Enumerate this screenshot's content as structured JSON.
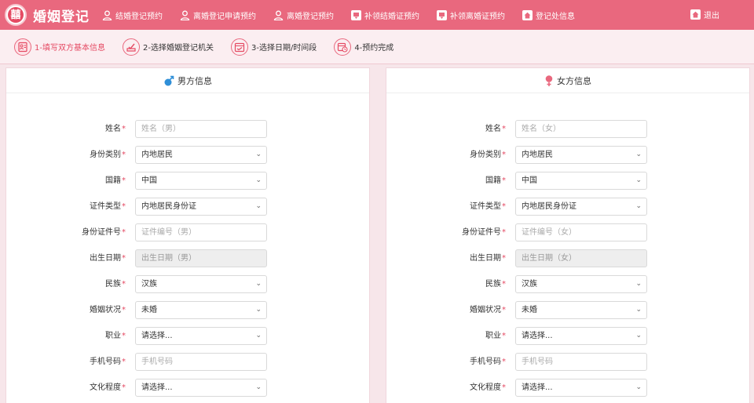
{
  "header": {
    "logo_glyph": "囍",
    "title": "婚姻登记",
    "nav": [
      {
        "label": "结婚登记预约",
        "icon": "person-icon"
      },
      {
        "label": "离婚登记申请预约",
        "icon": "person-icon"
      },
      {
        "label": "离婚登记预约",
        "icon": "person-icon"
      },
      {
        "label": "补领结婚证预约",
        "icon": "certificate-icon"
      },
      {
        "label": "补领离婚证预约",
        "icon": "certificate-icon"
      },
      {
        "label": "登记处信息",
        "icon": "home-icon"
      }
    ],
    "logout_label": "退出"
  },
  "steps": [
    {
      "label": "1-填写双方基本信息",
      "active": true
    },
    {
      "label": "2-选择婚姻登记机关",
      "active": false
    },
    {
      "label": "3-选择日期/时间段",
      "active": false
    },
    {
      "label": "4-预约完成",
      "active": false
    }
  ],
  "colors": {
    "brand": "#e9687e",
    "accent": "#e54a63",
    "male": "#2f8fd8",
    "female": "#e9687e"
  },
  "male": {
    "title": "男方信息",
    "fields": [
      {
        "label": "姓名",
        "type": "input",
        "placeholder": "姓名（男）"
      },
      {
        "label": "身份类别",
        "type": "select",
        "value": "内地居民"
      },
      {
        "label": "国籍",
        "type": "select",
        "value": "中国"
      },
      {
        "label": "证件类型",
        "type": "select",
        "value": "内地居民身份证"
      },
      {
        "label": "身份证件号",
        "type": "input",
        "placeholder": "证件编号（男）"
      },
      {
        "label": "出生日期",
        "type": "disabled",
        "placeholder": "出生日期（男）"
      },
      {
        "label": "民族",
        "type": "select",
        "value": "汉族"
      },
      {
        "label": "婚姻状况",
        "type": "select",
        "value": "未婚"
      },
      {
        "label": "职业",
        "type": "select",
        "value": "请选择..."
      },
      {
        "label": "手机号码",
        "type": "input",
        "placeholder": "手机号码"
      },
      {
        "label": "文化程度",
        "type": "select",
        "value": "请选择..."
      }
    ]
  },
  "female": {
    "title": "女方信息",
    "fields": [
      {
        "label": "姓名",
        "type": "input",
        "placeholder": "姓名（女）"
      },
      {
        "label": "身份类别",
        "type": "select",
        "value": "内地居民"
      },
      {
        "label": "国籍",
        "type": "select",
        "value": "中国"
      },
      {
        "label": "证件类型",
        "type": "select",
        "value": "内地居民身份证"
      },
      {
        "label": "身份证件号",
        "type": "input",
        "placeholder": "证件编号（女）"
      },
      {
        "label": "出生日期",
        "type": "disabled",
        "placeholder": "出生日期（女）"
      },
      {
        "label": "民族",
        "type": "select",
        "value": "汉族"
      },
      {
        "label": "婚姻状况",
        "type": "select",
        "value": "未婚"
      },
      {
        "label": "职业",
        "type": "select",
        "value": "请选择..."
      },
      {
        "label": "手机号码",
        "type": "input",
        "placeholder": "手机号码"
      },
      {
        "label": "文化程度",
        "type": "select",
        "value": "请选择..."
      }
    ]
  }
}
